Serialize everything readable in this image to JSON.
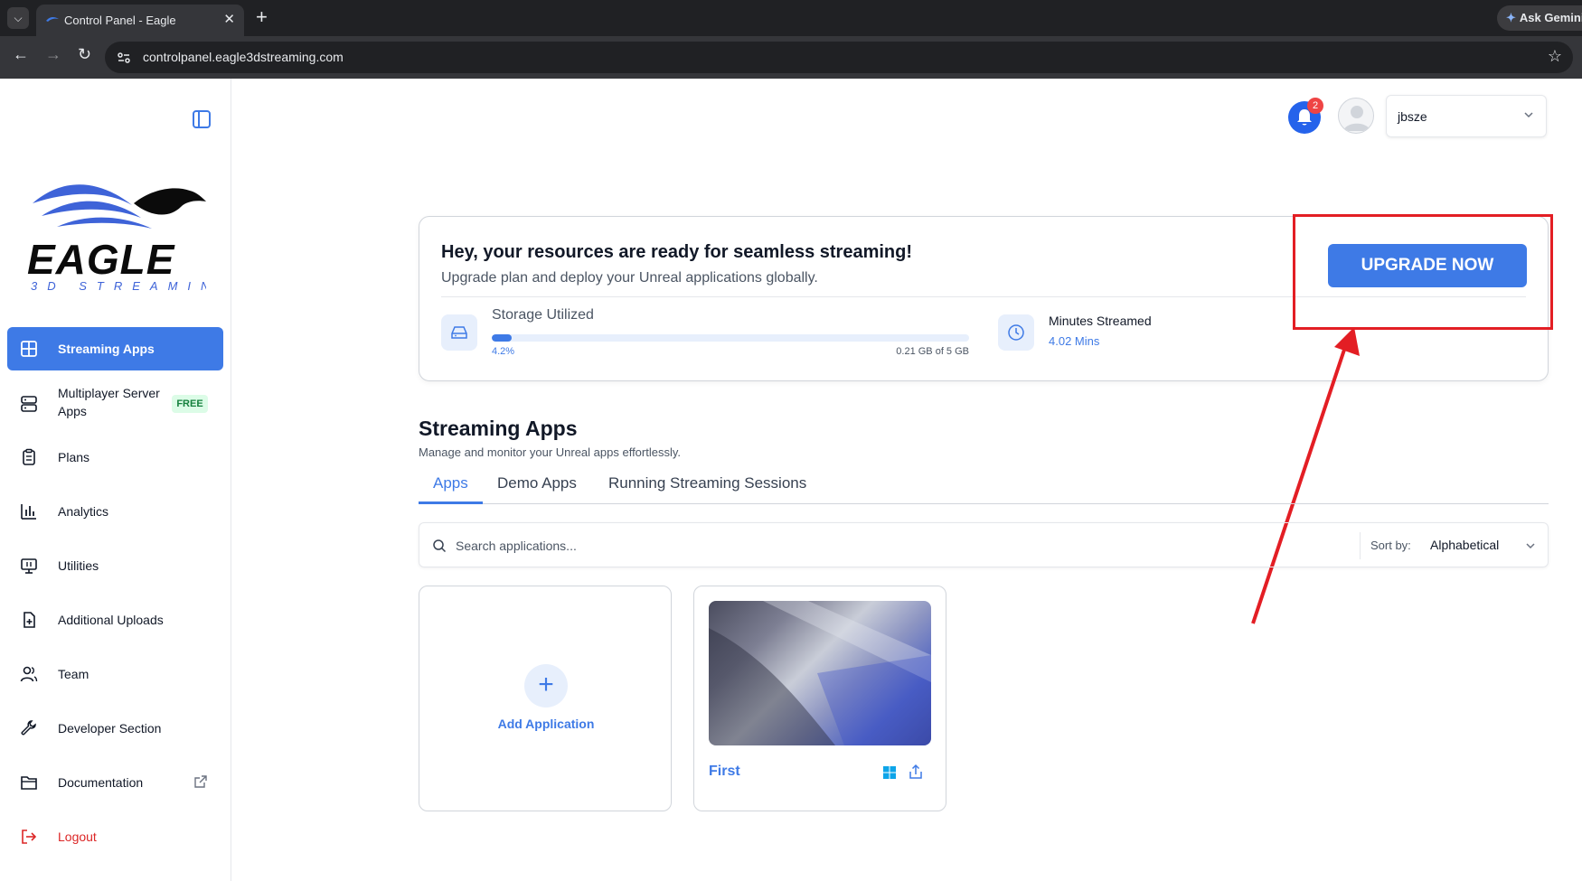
{
  "browser": {
    "tab_title": "Control Panel - Eagle",
    "url": "controlpanel.eagle3dstreaming.com",
    "gemini_label": "Ask Gemini"
  },
  "sidebar": {
    "items": [
      {
        "label": "Streaming Apps",
        "icon": "grid-icon",
        "active": true
      },
      {
        "label": "Multiplayer Server",
        "label2": "Apps",
        "icon": "server-icon",
        "badge": "FREE"
      },
      {
        "label": "Plans",
        "icon": "clipboard-icon"
      },
      {
        "label": "Analytics",
        "icon": "bar-chart-icon"
      },
      {
        "label": "Utilities",
        "icon": "monitor-icon"
      },
      {
        "label": "Additional Uploads",
        "icon": "file-plus-icon"
      },
      {
        "label": "Team",
        "icon": "users-icon"
      },
      {
        "label": "Developer Section",
        "icon": "wrench-icon"
      },
      {
        "label": "Documentation",
        "icon": "folder-icon"
      },
      {
        "label": "Logout",
        "icon": "logout-icon"
      }
    ]
  },
  "header": {
    "notification_count": "2",
    "username": "jbsze"
  },
  "resources": {
    "headline": "Hey, your resources are ready for seamless streaming!",
    "subtitle": "Upgrade plan and deploy your Unreal applications globally.",
    "storage_label": "Storage Utilized",
    "storage_percent_text": "4.2%",
    "storage_percent": 4.2,
    "storage_amount": "0.21 GB of 5 GB",
    "minutes_label": "Minutes Streamed",
    "minutes_value": "4.02 Mins",
    "upgrade_label": "UPGRADE NOW"
  },
  "apps_section": {
    "title": "Streaming Apps",
    "subtitle": "Manage and monitor your Unreal apps effortlessly.",
    "tabs": [
      "Apps",
      "Demo Apps",
      "Running Streaming Sessions"
    ],
    "search_placeholder": "Search applications...",
    "sort_label": "Sort by:",
    "sort_value": "Alphabetical",
    "add_label": "Add Application",
    "apps": [
      {
        "name": "First",
        "platform": "windows-icon"
      }
    ]
  },
  "colors": {
    "accent": "#3e7ae6",
    "annotation": "#e31e24",
    "logout": "#dc2626"
  }
}
